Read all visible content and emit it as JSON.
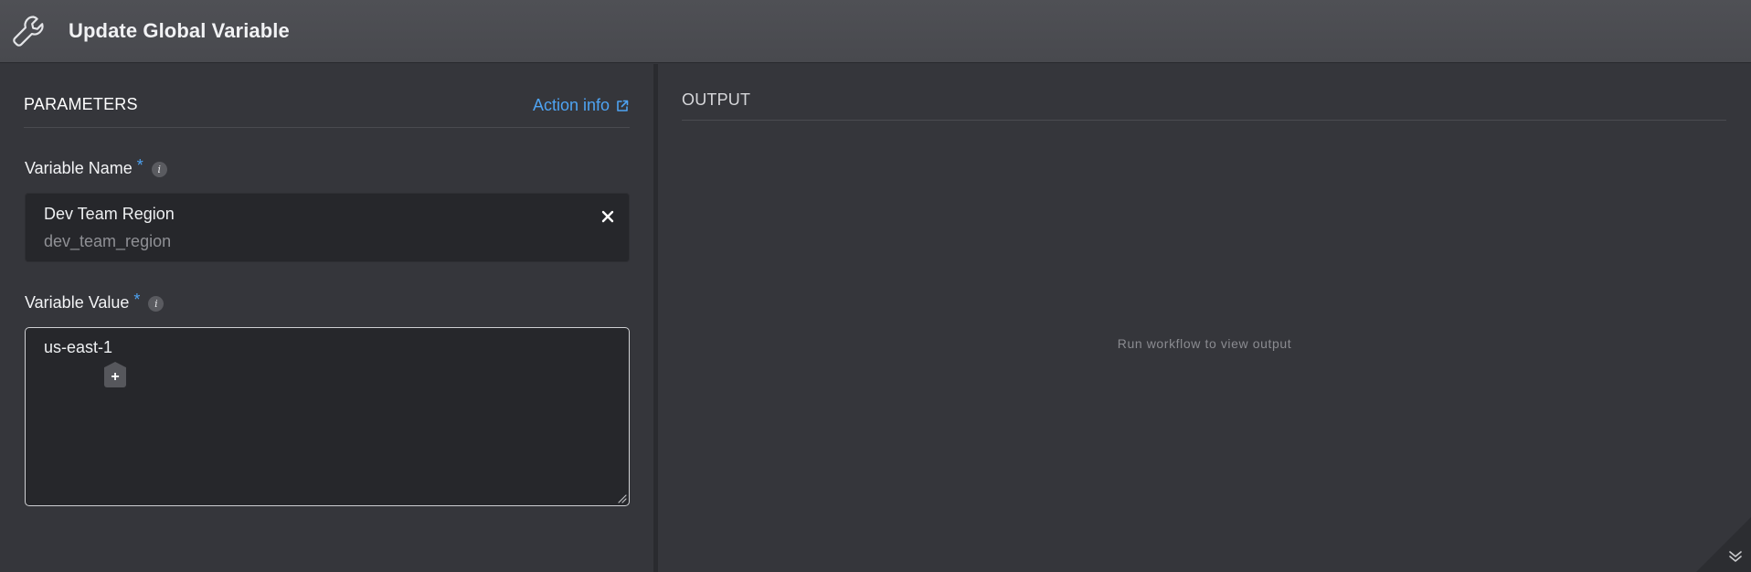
{
  "header": {
    "title": "Update Global Variable",
    "icon": "wrench-icon"
  },
  "parameters": {
    "section_title": "PARAMETERS",
    "action_info_label": "Action info",
    "variable_name": {
      "label": "Variable Name",
      "required_mark": "*",
      "info_glyph": "i",
      "selected_display": "Dev Team Region",
      "selected_key": "dev_team_region",
      "clear_icon": "close-icon"
    },
    "variable_value": {
      "label": "Variable Value",
      "required_mark": "*",
      "info_glyph": "i",
      "value": "us-east-1",
      "insert_glyph": "+"
    }
  },
  "output": {
    "section_title": "OUTPUT",
    "empty_message": "Run workflow to view output"
  },
  "colors": {
    "accent": "#4ea3f2",
    "panel_bg": "#35363b",
    "header_bg": "#4b4c51",
    "input_bg": "#26272b"
  }
}
